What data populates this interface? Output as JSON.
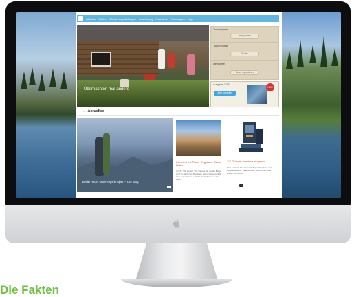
{
  "headline": "Die Fakten",
  "site": {
    "nav": {
      "items": [
        "Aktuelle",
        "Wetter",
        "Wanderempfehlungen",
        "Ausrüstung",
        "Newsletter",
        "Fotowagen",
        "Impr"
      ]
    },
    "hero": {
      "caption": "Übernachten mal anders"
    },
    "widgets": [
      {
        "title": "Tourenplaner",
        "button": "jetzt planen"
      },
      {
        "title": "Tourenportal",
        "button": "Suche"
      },
      {
        "title": "Newsletter",
        "button": "Jetzt registrieren"
      }
    ],
    "magazine": {
      "title": "Ausgabe 2/15",
      "button": "Jetzt bestellen",
      "badge": "NEU"
    },
    "section": {
      "title": "Aktuelles"
    },
    "blog": {
      "caption": "Berlin Heuer Unterwegs in Alpen – Der Blog"
    },
    "card2": {
      "title": "Interview mit Tiroler Regisseur Simon Hofer",
      "text": "Am 27. Mai kommt \"Die Träume da, wo die Berge sind\" in die Kinos. Regisseur Simon Hofer erzählt über seine Heimat und die Dreharbeiten in den Alpen."
    },
    "card3": {
      "title": "111 Gründe, wandern zu gehen",
      "text": "Ein Lesebuch für leidenschaftliche Wanderer und Bergbegeisterte – alle Gründe, warum wir immer wieder los ziehen."
    }
  },
  "colors": {
    "nav": "#5fb7e1",
    "accent": "#e2672a",
    "headline": "#6fc043"
  }
}
